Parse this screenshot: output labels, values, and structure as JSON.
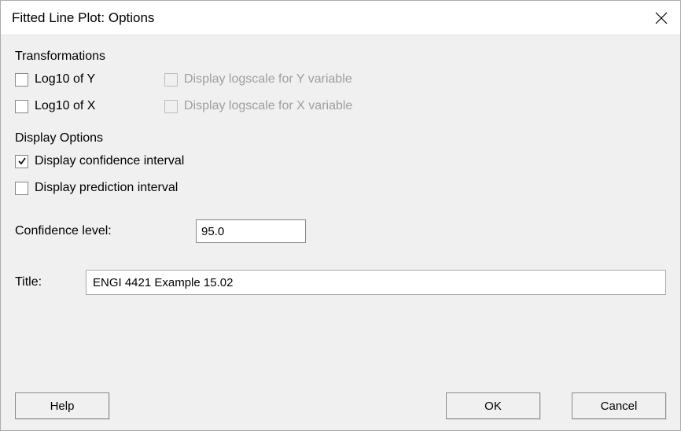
{
  "dialog": {
    "title": "Fitted Line Plot: Options"
  },
  "transformations": {
    "heading": "Transformations",
    "log10_y_label": "Log10 of Y",
    "log10_x_label": "Log10 of X",
    "logscale_y_label": "Display logscale for Y variable",
    "logscale_x_label": "Display logscale for X variable",
    "log10_y_checked": false,
    "log10_x_checked": false,
    "logscale_y_checked": false,
    "logscale_x_checked": false,
    "logscale_y_enabled": false,
    "logscale_x_enabled": false
  },
  "display_options": {
    "heading": "Display Options",
    "confidence_interval_label": "Display confidence interval",
    "prediction_interval_label": "Display prediction interval",
    "confidence_interval_checked": true,
    "prediction_interval_checked": false
  },
  "confidence_level": {
    "label": "Confidence level:",
    "value": "95.0"
  },
  "title_field": {
    "label": "Title:",
    "value": "ENGI 4421 Example 15.02"
  },
  "buttons": {
    "help": "Help",
    "ok": "OK",
    "cancel": "Cancel"
  }
}
